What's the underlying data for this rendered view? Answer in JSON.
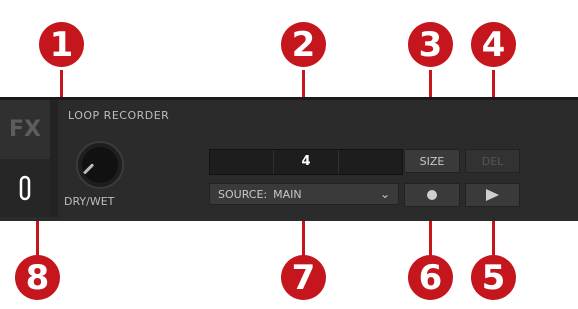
{
  "module": {
    "tab_fx": "FX",
    "title": "LOOP RECORDER",
    "knob_label": "DRY/WET",
    "loop_size_value": "4",
    "size_button": "SIZE",
    "delete_button": "DEL",
    "source_label": "SOURCE:",
    "source_value": "MAIN",
    "record_icon": "record-icon",
    "play_icon": "play-icon",
    "loop_icon": "loop-icon"
  },
  "callouts": [
    "1",
    "2",
    "3",
    "4",
    "5",
    "6",
    "7",
    "8"
  ],
  "colors": {
    "callout": "#c4161c",
    "panel": "#2b2b2b"
  }
}
